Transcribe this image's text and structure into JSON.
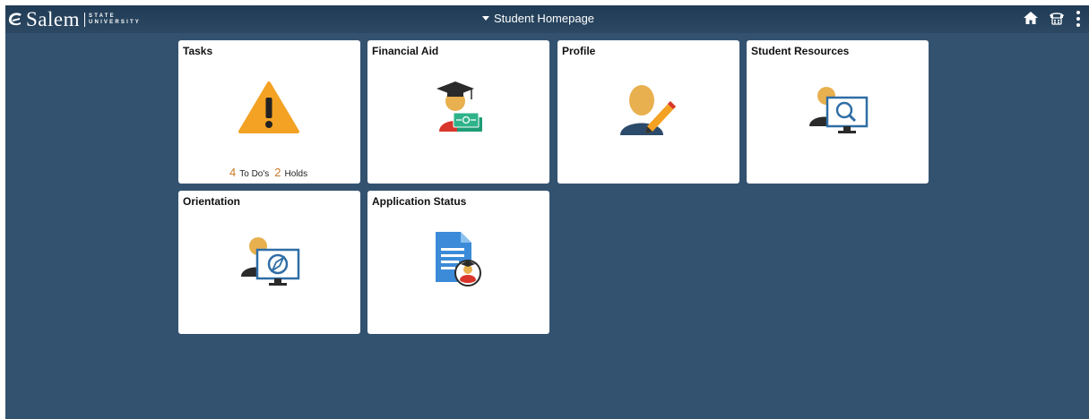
{
  "header": {
    "logo_text": "Salem",
    "logo_sub_line1": "STATE",
    "logo_sub_line2": "UNIVERSITY",
    "page_title": "Student Homepage",
    "icons": [
      "home-icon",
      "navbar-icon",
      "more-actions-icon"
    ]
  },
  "tiles": [
    {
      "title": "Tasks",
      "icon": "warning-icon",
      "todo_count": "4",
      "todo_label": "To Do's",
      "holds_count": "2",
      "holds_label": "Holds"
    },
    {
      "title": "Financial Aid",
      "icon": "graduate-money-icon"
    },
    {
      "title": "Profile",
      "icon": "user-edit-icon"
    },
    {
      "title": "Student Resources",
      "icon": "user-search-monitor-icon"
    },
    {
      "title": "Orientation",
      "icon": "user-compass-monitor-icon"
    },
    {
      "title": "Application Status",
      "icon": "document-graduate-icon"
    }
  ],
  "colors": {
    "background": "#33526f",
    "header": "#1f3b56",
    "warning": "#f3a224",
    "accent_count": "#c87a2a",
    "monitor_blue": "#2f6ea6",
    "doc_blue": "#3b8bd8"
  }
}
